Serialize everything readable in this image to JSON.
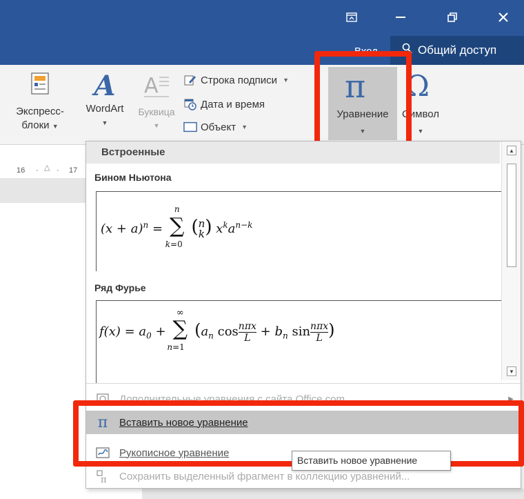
{
  "window_controls": {
    "restore_ribbon_icon": "ribbon-display-icon",
    "minimize_icon": "minimize-icon",
    "maximize_icon": "restore-icon",
    "close_icon": "close-icon"
  },
  "account": {
    "signin_label": "Вход",
    "share_label": "Общий доступ",
    "share_icon": "person-icon"
  },
  "ribbon": {
    "quick_parts": {
      "line1": "Экспресс-",
      "line2": "блоки",
      "icon": "quick-parts-icon"
    },
    "wordart": {
      "label": "WordArt",
      "icon": "wordart-icon"
    },
    "dropcap": {
      "label": "Буквица",
      "icon": "dropcap-icon",
      "disabled": true
    },
    "signature_line": "Строка подписи",
    "date_time": "Дата и время",
    "object": "Объект",
    "equation": {
      "label": "Уравнение",
      "icon": "pi-icon",
      "glyph": "π"
    },
    "symbol": {
      "label": "Символ",
      "icon": "omega-icon",
      "glyph": "Ω"
    }
  },
  "ruler": {
    "mark1": "16",
    "mark2": "17"
  },
  "gallery": {
    "category": "Встроенные",
    "equations": [
      {
        "title": "Бином Ньютона",
        "name": "binomial-theorem"
      },
      {
        "title": "Ряд Фурье",
        "name": "fourier-series"
      }
    ]
  },
  "menu": {
    "more_equations": "Дополнительные уравнения с сайта Office.com",
    "insert_new": "Вставить новое уравнение",
    "ink_equation": "Рукописное уравнение",
    "save_selection": "Сохранить выделенный фрагмент в коллекцию уравнений..."
  },
  "tooltip": "Вставить новое уравнение",
  "colors": {
    "titlebar": "#2b579a",
    "highlight": "#f2280c",
    "accent_icon": "#3b67a6",
    "hover_gray": "#c8c8c8"
  }
}
